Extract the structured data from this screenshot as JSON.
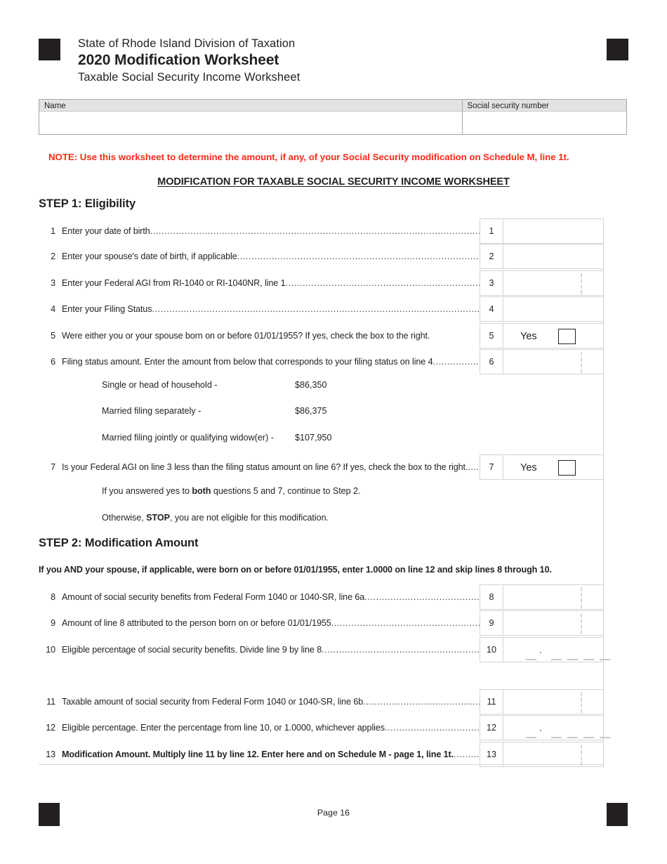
{
  "header": {
    "agency": "State of Rhode Island Division of Taxation",
    "title": "2020 Modification Worksheet",
    "subtitle": "Taxable Social Security Income Worksheet"
  },
  "identity": {
    "name_label": "Name",
    "ssn_label": "Social security number",
    "name_value": "",
    "ssn_value": ""
  },
  "note": "NOTE:  Use this worksheet to determine the amount, if any, of your Social Security modification on Schedule M, line 1t.",
  "worksheet_title": "MODIFICATION FOR TAXABLE SOCIAL SECURITY INCOME WORKSHEET",
  "step1": {
    "heading": "STEP 1: Eligibility",
    "lines": [
      {
        "num": "1",
        "label": "Enter your date of birth",
        "cell_num": "1",
        "value": "",
        "type": "plain"
      },
      {
        "num": "2",
        "label": "Enter your spouse's date of birth, if applicable",
        "cell_num": "2",
        "value": "",
        "type": "plain"
      },
      {
        "num": "3",
        "label": "Enter your Federal AGI from RI-1040 or RI-1040NR, line 1",
        "cell_num": "3",
        "value": "",
        "type": "money"
      },
      {
        "num": "4",
        "label": "Enter your Filing Status",
        "cell_num": "4",
        "value": "",
        "type": "plain"
      },
      {
        "num": "5",
        "label": "Were either you or your spouse born on or before 01/01/1955?  If yes, check the box to the right.",
        "cell_num": "5",
        "yes_label": "Yes",
        "checked": false,
        "type": "yesbox"
      },
      {
        "num": "6",
        "label": "Filing status amount.  Enter the amount from below that corresponds to your filing status on line 4",
        "cell_num": "6",
        "value": "",
        "type": "money"
      },
      {
        "num": "7",
        "label": "Is your Federal AGI on line 3 less than the filing status amount on line 6? If yes, check the box to the right.",
        "cell_num": "7",
        "yes_label": "Yes",
        "checked": false,
        "type": "yesbox"
      }
    ],
    "filing_status_table": [
      {
        "label": "Single or head of household -",
        "amount": "$86,350"
      },
      {
        "label": "Married filing separately -",
        "amount": "$86,375"
      },
      {
        "label": "Married filing jointly or qualifying widow(er) -",
        "amount": "$107,950"
      }
    ],
    "continue_text_prefix": "If you answered yes to ",
    "continue_text_bold": "both",
    "continue_text_suffix": " questions 5 and 7, continue to Step 2.",
    "stop_text_prefix": "Otherwise, ",
    "stop_text_bold": "STOP",
    "stop_text_suffix": ", you are not eligible for this modification."
  },
  "step2": {
    "heading": "STEP 2: Modification Amount",
    "note": "If you AND your spouse, if applicable, were born on or before 01/01/1955, enter 1.0000 on line 12 and skip lines 8 through 10.",
    "lines": [
      {
        "num": "8",
        "label": "Amount of social security benefits from Federal Form 1040 or 1040-SR, line 6a",
        "cell_num": "8",
        "value": "",
        "type": "money"
      },
      {
        "num": "9",
        "label": "Amount of line 8 attributed to the person born on or before 01/01/1955",
        "cell_num": "9",
        "value": "",
        "type": "money"
      },
      {
        "num": "10",
        "label": "Eligible percentage of social security benefits.  Divide line 9 by line 8",
        "cell_num": "10",
        "value": "",
        "type": "decimal"
      },
      {
        "num": "11",
        "label": "Taxable amount of social security from Federal Form 1040 or 1040-SR, line 6b",
        "cell_num": "11",
        "value": "",
        "type": "money"
      },
      {
        "num": "12",
        "label": "Eligible percentage.  Enter the percentage from line 10, or 1.0000, whichever applies",
        "cell_num": "12",
        "value": "",
        "type": "decimal"
      },
      {
        "num": "13",
        "label": "Modification Amount. Multiply line 11 by line 12.  Enter here and on Schedule M - page 1, line 1t.",
        "cell_num": "13",
        "value": "",
        "type": "money",
        "bold": true
      }
    ]
  },
  "footer": {
    "page_label": "Page 16"
  },
  "colors": {
    "note_red": "#ff2a18",
    "text": "#231f20",
    "rule": "#d4d4d4",
    "label_fill": "#e3e3e3"
  }
}
